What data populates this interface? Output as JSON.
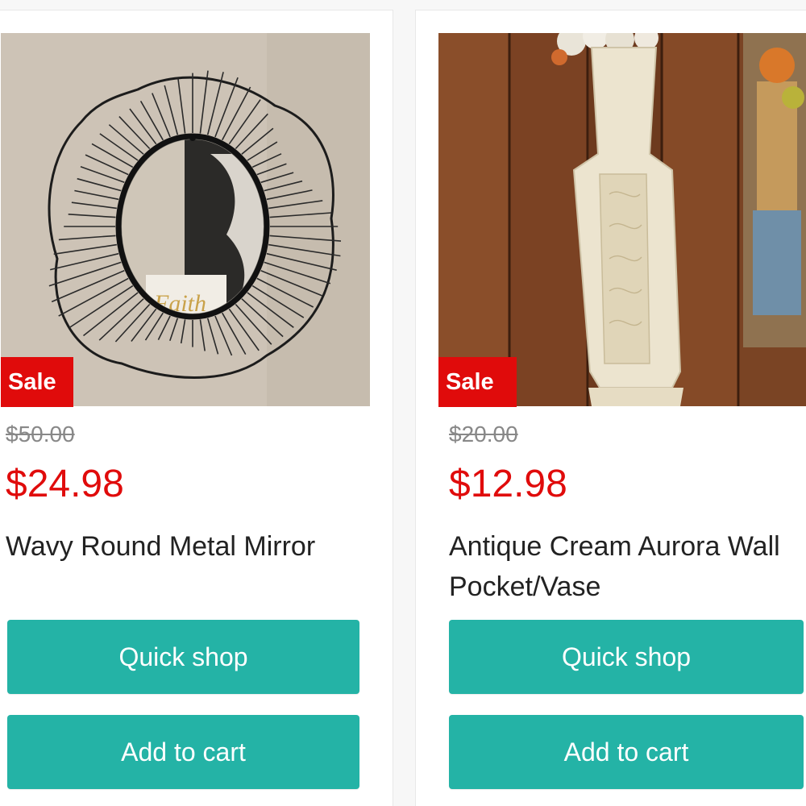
{
  "products": [
    {
      "badge": "Sale",
      "original_price": "$50.00",
      "sale_price": "$24.98",
      "title": "Wavy Round Metal Mirror",
      "quick_shop_label": "Quick shop",
      "add_to_cart_label": "Add to cart",
      "image_text": "Faith"
    },
    {
      "badge": "Sale",
      "original_price": "$20.00",
      "sale_price": "$12.98",
      "title": "Antique Cream Aurora Wall Pocket/Vase",
      "quick_shop_label": "Quick shop",
      "add_to_cart_label": "Add to cart"
    }
  ],
  "colors": {
    "sale_red": "#e00b0b",
    "button_teal": "#24b3a6",
    "strike_gray": "#888888"
  }
}
